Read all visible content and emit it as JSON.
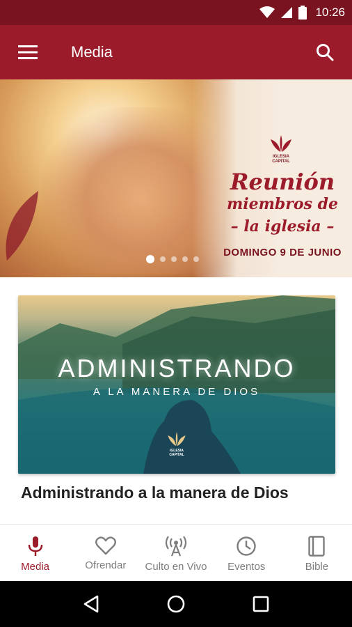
{
  "status_bar": {
    "time": "10:26"
  },
  "app_bar": {
    "title": "Media"
  },
  "hero": {
    "logo_text": "IGLESIA CAPITAL",
    "title": "Reunión",
    "subtitle_line1": "miembros de",
    "subtitle_line2": "– la iglesia –",
    "date": "DOMINGO 9 DE JUNIO",
    "slides_total": 5,
    "slide_active": 1
  },
  "card": {
    "image_title": "ADMINISTRANDO",
    "image_subtitle": "A LA MANERA DE DIOS",
    "logo_text": "IGLESIA CAPITAL",
    "title": "Administrando a la manera de Dios"
  },
  "bottom_nav": {
    "items": [
      {
        "label": "Media",
        "icon": "microphone-icon",
        "active": true
      },
      {
        "label": "Ofrendar",
        "icon": "heart-icon",
        "active": false
      },
      {
        "label": "Culto en Vivo",
        "icon": "broadcast-icon",
        "active": false
      },
      {
        "label": "Eventos",
        "icon": "clock-icon",
        "active": false
      },
      {
        "label": "Bible",
        "icon": "book-icon",
        "active": false
      }
    ]
  },
  "colors": {
    "primary": "#9c1b2a",
    "primary_dark": "#7a1320",
    "inactive": "#7d7d7d"
  }
}
